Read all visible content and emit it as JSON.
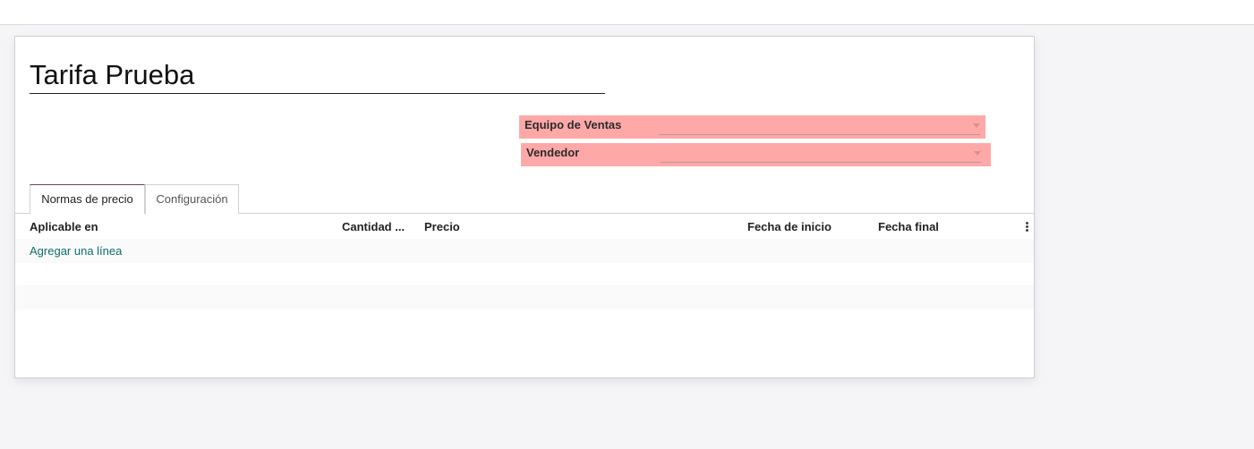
{
  "record": {
    "title": "Tarifa Prueba"
  },
  "fields": {
    "sales_team": {
      "label": "Equipo de Ventas",
      "value": ""
    },
    "salesperson": {
      "label": "Vendedor",
      "value": ""
    }
  },
  "tabs": [
    {
      "label": "Normas de precio",
      "active": true
    },
    {
      "label": "Configuración",
      "active": false
    }
  ],
  "table": {
    "columns": [
      "Aplicable en",
      "Cantidad ...",
      "Precio",
      "Fecha de inicio",
      "Fecha final"
    ],
    "add_line_label": "Agregar una línea"
  },
  "colors": {
    "field_highlight": "#ffa8a8",
    "link": "#0e6e6e",
    "active_tab_border": "#6b3e5e"
  },
  "icons": [
    "chevron-down-icon",
    "kebab-menu-icon"
  ]
}
